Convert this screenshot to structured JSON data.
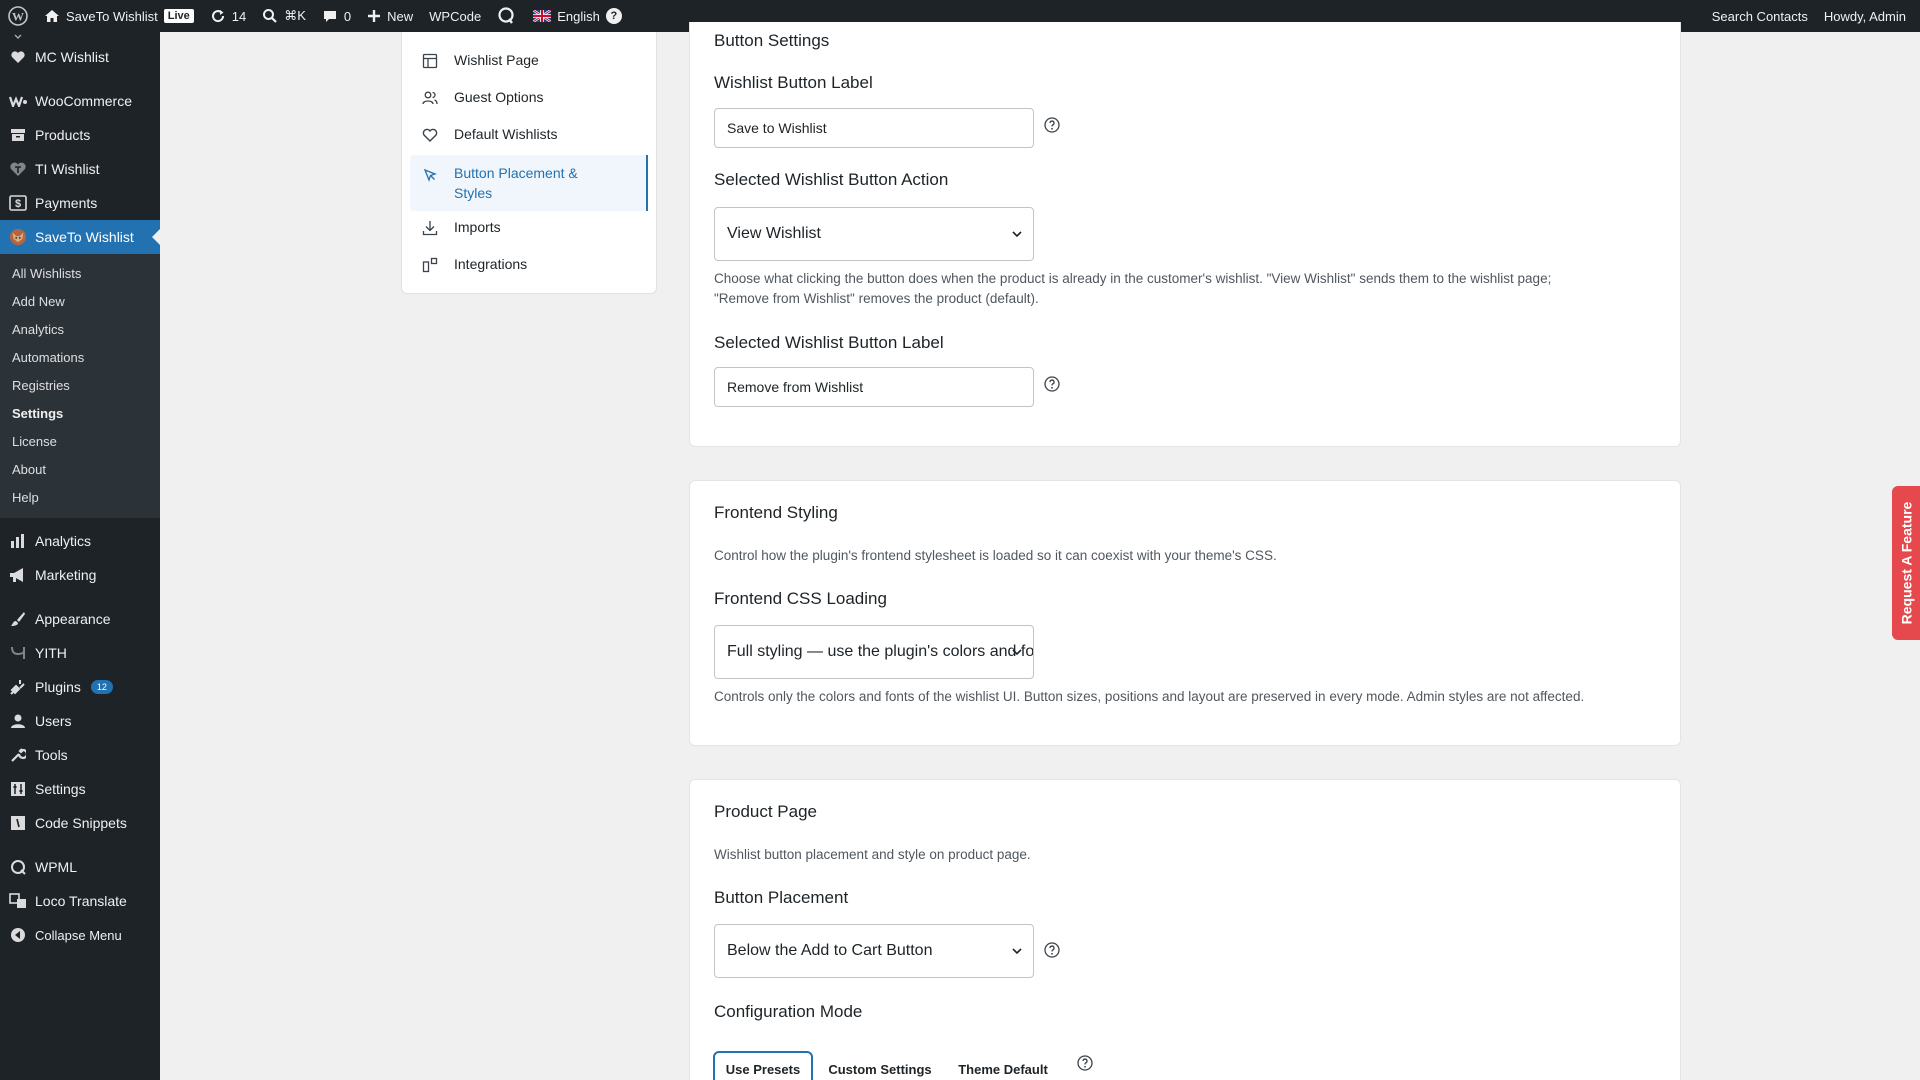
{
  "adminbar": {
    "site_name": "SaveTo Wishlist",
    "live_badge": "Live",
    "updates_count": "14",
    "search_shortcut": "⌘K",
    "comments_count": "0",
    "new_label": "New",
    "wpcode_label": "WPCode",
    "language_label": "English",
    "language_help": "?",
    "search_contacts": "Search Contacts",
    "howdy": "Howdy, Admin"
  },
  "sidebar": {
    "top_item": "MC Wishlist",
    "items_a": [
      {
        "label": "WooCommerce",
        "icon": "woo-icon"
      },
      {
        "label": "Products",
        "icon": "archive-icon"
      },
      {
        "label": "TI Wishlist",
        "icon": "heart-icon"
      },
      {
        "label": "Payments",
        "icon": "dollar-icon"
      }
    ],
    "current": "SaveTo Wishlist",
    "submenu": [
      "All Wishlists",
      "Add New",
      "Analytics",
      "Automations",
      "Registries",
      "Settings",
      "License",
      "About",
      "Help"
    ],
    "active_submenu": "Settings",
    "items_b": [
      {
        "label": "Analytics",
        "icon": "chart-icon"
      },
      {
        "label": "Marketing",
        "icon": "megaphone-icon"
      }
    ],
    "items_c": [
      {
        "label": "Appearance",
        "icon": "brush-icon"
      },
      {
        "label": "YITH",
        "icon": "yith-icon"
      },
      {
        "label": "Plugins",
        "icon": "plug-icon",
        "badge": "12"
      },
      {
        "label": "Users",
        "icon": "user-icon"
      },
      {
        "label": "Tools",
        "icon": "wrench-icon"
      },
      {
        "label": "Settings",
        "icon": "sliders-icon"
      },
      {
        "label": "Code Snippets",
        "icon": "code-icon"
      }
    ],
    "items_d": [
      {
        "label": "WPML",
        "icon": "wpml-icon"
      },
      {
        "label": "Loco Translate",
        "icon": "translate-icon"
      },
      {
        "label": "Collapse Menu",
        "icon": "collapse-icon"
      }
    ]
  },
  "settings_nav": {
    "items": [
      {
        "label": "Wishlist Page",
        "icon": "layout-icon"
      },
      {
        "label": "Guest Options",
        "icon": "users-icon"
      },
      {
        "label": "Default Wishlists",
        "icon": "heart-outline-icon"
      },
      {
        "label": "Button Placement & Styles",
        "icon": "cursor-icon",
        "active": true
      },
      {
        "label": "Imports",
        "icon": "download-icon"
      },
      {
        "label": "Integrations",
        "icon": "integrations-icon"
      }
    ]
  },
  "button_settings": {
    "title": "Button Settings",
    "label_heading": "Wishlist Button Label",
    "label_value": "Save to Wishlist",
    "action_heading": "Selected Wishlist Button Action",
    "action_value": "View Wishlist",
    "action_desc_1": "Choose what clicking the button does when the product is already in the customer's wishlist. \"View Wishlist\" sends them to the wishlist page;",
    "action_desc_2": "\"Remove from Wishlist\" removes the product (default).",
    "selected_label_heading": "Selected Wishlist Button Label",
    "selected_label_value": "Remove from Wishlist"
  },
  "frontend_styling": {
    "title": "Frontend Styling",
    "desc": "Control how the plugin's frontend stylesheet is loaded so it can coexist with your theme's CSS.",
    "css_heading": "Frontend CSS Loading",
    "css_value": "Full styling — use the plugin's colors and fonts",
    "css_desc": "Controls only the colors and fonts of the wishlist UI. Button sizes, positions and layout are preserved in every mode. Admin styles are not affected."
  },
  "product_page": {
    "title": "Product Page",
    "desc": "Wishlist button placement and style on product page.",
    "placement_heading": "Button Placement",
    "placement_value": "Below the Add to Cart Button",
    "config_heading": "Configuration Mode",
    "modes": [
      "Use Presets",
      "Custom Settings",
      "Theme Default"
    ],
    "selected_mode": "Use Presets"
  },
  "request_feature": "Request A Feature"
}
